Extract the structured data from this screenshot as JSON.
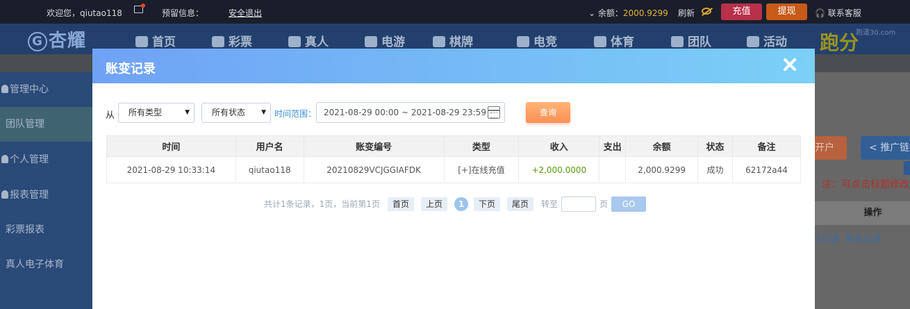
{
  "topbar": {
    "welcome": "欢迎您，qiutao118",
    "reserve_info": "预留信息：",
    "logout": "安全退出",
    "balance_label": "余额：",
    "balance_value": "2000.9299",
    "refresh": "刷新",
    "recharge": "充值",
    "withdraw": "提现",
    "service": "联系客服"
  },
  "nav": {
    "logo": "杏耀",
    "items": [
      "首页",
      "彩票",
      "真人",
      "电游",
      "棋牌",
      "电竞",
      "体育",
      "团队",
      "活动"
    ],
    "run": "跑分",
    "watermark": "跑道30.com"
  },
  "sidebar": {
    "items": [
      "管理中心",
      "团队管理",
      "个人管理",
      "报表管理",
      "彩票报表",
      "真人电子体育"
    ]
  },
  "background": {
    "btn_open_account": "开户",
    "btn_promo": "推广链接",
    "note": "注：可点击标题修改",
    "col_op": "操作",
    "link_bet": "注记录",
    "link_change": "账变记录"
  },
  "modal": {
    "title": "账变记录",
    "from_label": "从",
    "type_select": "所有类型",
    "status_select": "所有状态",
    "range_label": "时间范围：",
    "date_range": "2021-08-29 00:00 ~ 2021-08-29 23:59",
    "query": "查询",
    "table": {
      "headers": [
        "时间",
        "用户名",
        "账变编号",
        "类型",
        "收入",
        "支出",
        "余额",
        "状态",
        "备注"
      ],
      "rows": [
        [
          "2021-08-29 10:33:14",
          "qiutao118",
          "20210829VCJGGIAFDK",
          "[+]在线充值",
          "+2,000.0000",
          "",
          "2,000.9299",
          "成功",
          "62172a44"
        ]
      ]
    },
    "pager": {
      "summary": "共计1条记录，1页，当前第1页",
      "first": "首页",
      "prev": "上页",
      "current": "1",
      "next": "下页",
      "last": "尾页",
      "goto": "转至",
      "page_unit": "页",
      "go": "GO"
    }
  },
  "colors": {
    "modal_header_start": "#6fa2f5",
    "modal_header_end": "#7bd0f7",
    "query_button": "#fb8f55",
    "income": "#5a9a13",
    "balance": "#e7b23b"
  }
}
